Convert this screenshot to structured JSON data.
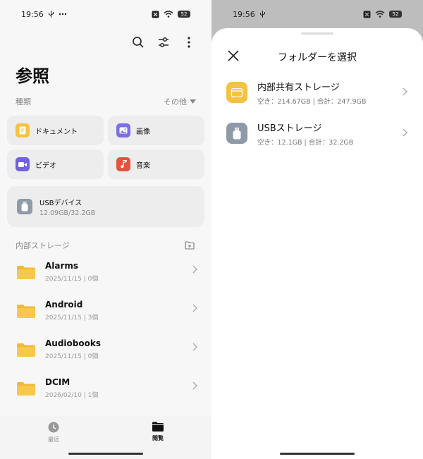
{
  "status": {
    "time": "19:56",
    "battery": "52"
  },
  "browse": {
    "title": "参照",
    "categories_label": "種類",
    "sort_label": "その他",
    "categories": [
      {
        "label": "ドキュメント",
        "icon": "document-icon",
        "color": "#f5c342"
      },
      {
        "label": "画像",
        "icon": "image-icon",
        "color": "#7b6ee6"
      },
      {
        "label": "ビデオ",
        "icon": "video-icon",
        "color": "#6f63e0"
      },
      {
        "label": "音楽",
        "icon": "music-icon",
        "color": "#e4533d"
      }
    ],
    "usb_device": {
      "name": "USBデバイス",
      "usage": "12.09GB/32.2GB"
    },
    "internal_label": "内部ストレージ",
    "folders": [
      {
        "name": "Alarms",
        "meta": "2025/11/15  |  0個"
      },
      {
        "name": "Android",
        "meta": "2025/11/15  |  3個"
      },
      {
        "name": "Audiobooks",
        "meta": "2025/11/15  |  0個"
      },
      {
        "name": "DCIM",
        "meta": "2026/02/10  |  1個"
      }
    ]
  },
  "nav": {
    "recent": "最近",
    "browse": "閲覧"
  },
  "sheet": {
    "title": "フォルダーを選択",
    "destinations": [
      {
        "name": "内部共有ストレージ",
        "sub": "空き：214.67GB | 合計：247.9GB",
        "color": "#f5c342"
      },
      {
        "name": "USBストレージ",
        "sub": "空き：12.1GB | 合計：32.2GB",
        "color": "#8f9aa8"
      }
    ]
  }
}
